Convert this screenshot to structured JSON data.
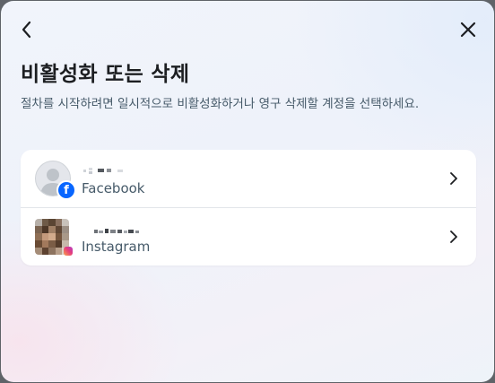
{
  "dialog": {
    "title": "비활성화 또는 삭제",
    "description": "절차를 시작하려면 일시적으로 비활성화하거나 영구 삭제할 계정을 선택하세요."
  },
  "icons": {
    "back": "chevron-left-icon",
    "close": "close-icon",
    "row_arrow": "chevron-right-icon"
  },
  "colors": {
    "facebook_blue": "#0866ff",
    "title_text": "#1c1e21",
    "secondary_text": "#465a69"
  },
  "accounts": [
    {
      "platform": "Facebook",
      "name": "",
      "avatar": "default-profile",
      "badge": "facebook-logo"
    },
    {
      "platform": "Instagram",
      "name": "",
      "avatar": "photo",
      "badge": "instagram-logo"
    }
  ]
}
